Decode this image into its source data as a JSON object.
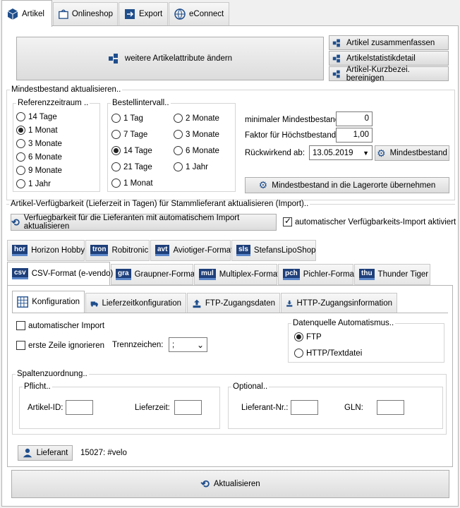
{
  "tabs": [
    {
      "label": "Artikel",
      "icon": "box-icon"
    },
    {
      "label": "Onlineshop",
      "icon": "shopping-bag-icon"
    },
    {
      "label": "Export",
      "icon": "export-icon"
    },
    {
      "label": "eConnect",
      "icon": "econnect-icon"
    }
  ],
  "toolbar": {
    "big_button": "weitere Artikelattribute ändern",
    "side_buttons": [
      "Artikel zusammenfassen",
      "Artikelstatistikdetail",
      "Artikel-Kurzbezei. bereinigen"
    ]
  },
  "mindestbestand": {
    "legend": "Mindestbestand aktualisieren..",
    "referenz": {
      "legend": "Referenzzeitraum ..",
      "options": [
        "14 Tage",
        "1 Monat",
        "3 Monate",
        "6 Monate",
        "9 Monate",
        "1 Jahr"
      ],
      "selected": "1 Monat"
    },
    "bestell": {
      "legend": "Bestellintervall..",
      "col1": [
        "1 Tag",
        "7 Tage",
        "14 Tage",
        "21 Tage",
        "1 Monat"
      ],
      "col2": [
        "2 Monate",
        "3 Monate",
        "6 Monate",
        "1 Jahr"
      ],
      "selected": "14 Tage"
    },
    "min_label": "minimaler Mindestbestand:",
    "min_value": "0",
    "faktor_label": "Faktor für Höchstbestand:",
    "faktor_value": "1,00",
    "rueck_label": "Rückwirkend ab:",
    "rueck_value": "13.05.2019",
    "mindest_button": "Mindestbestand",
    "lager_button": "Mindestbestand in die Lagerorte übernehmen"
  },
  "verfuegbarkeit": {
    "legend": "Artikel-Verfügbarkeit (Lieferzeit in Tagen) für Stammlieferant aktualisieren (Import)..",
    "update_button": "Verfuegbarkeit für die Lieferanten mit automatischem Import aktualisieren",
    "auto_label": "automatischer Verfügbarkeits-Import aktiviert",
    "auto_checked": true
  },
  "format_tabs_row1": [
    {
      "code": "hor",
      "label": "Horizon Hobby"
    },
    {
      "code": "tron",
      "label": "Robitronic"
    },
    {
      "code": "avt",
      "label": "Aviotiger-Format"
    },
    {
      "code": "sls",
      "label": "StefansLipoShop"
    }
  ],
  "format_tabs_row2": [
    {
      "code": "csv",
      "label": "CSV-Format (e-vendo)"
    },
    {
      "code": "gra",
      "label": "Graupner-Format"
    },
    {
      "code": "mul",
      "label": "Multiplex-Format"
    },
    {
      "code": "pch",
      "label": "Pichler-Format"
    },
    {
      "code": "thu",
      "label": "Thunder Tiger"
    }
  ],
  "config_tabs": [
    "Konfiguration",
    "Lieferzeitkonfiguration",
    "FTP-Zugangsdaten",
    "HTTP-Zugangsinformation"
  ],
  "config": {
    "auto_import": "automatischer Import",
    "first_row": "erste Zeile ignorieren",
    "trenn_label": "Trennzeichen:",
    "trenn_value": ";",
    "datenquelle_legend": "Datenquelle Automatismus..",
    "ds_ftp": "FTP",
    "ds_http": "HTTP/Textdatei",
    "spalten_legend": "Spaltenzuordnung..",
    "pflicht_legend": "Pflicht..",
    "artikel_id": "Artikel-ID:",
    "lieferzeit": "Lieferzeit:",
    "optional_legend": "Optional..",
    "lieferant_nr": "Lieferant-Nr.:",
    "gln": "GLN:",
    "lieferant_button": "Lieferant",
    "lieferant_value": "15027: #velo"
  },
  "aktualisieren": "Aktualisieren"
}
